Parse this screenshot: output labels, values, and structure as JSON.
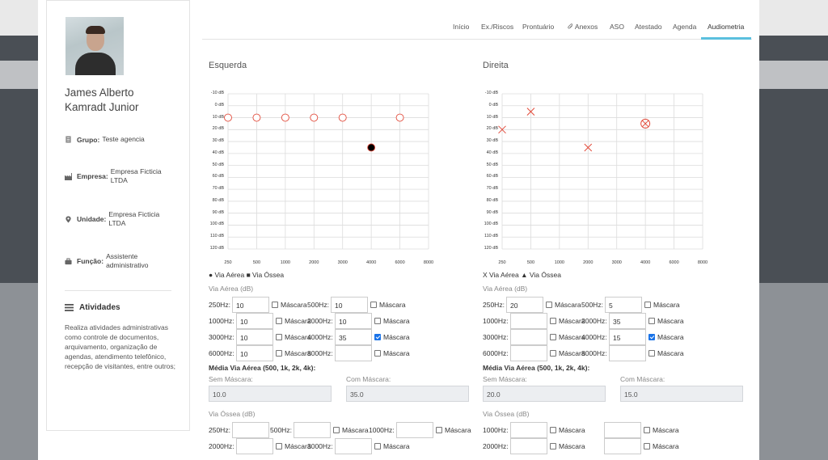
{
  "patient": {
    "name": "James Alberto Kamradt Junior",
    "grupo_label": "Grupo:",
    "grupo": "Teste agencia",
    "empresa_label": "Empresa:",
    "empresa": "Empresa Ficticia LTDA",
    "unidade_label": "Unidade:",
    "unidade": "Empresa Ficticia LTDA",
    "funcao_label": "Função:",
    "funcao": "Assistente administrativo"
  },
  "atividades": {
    "title": "Atividades",
    "description": "Realiza atividades administrativas como controle de documentos, arquivamento, organização de agendas, atendimento telefônico, recepção de visitantes, entre outros;"
  },
  "tabs": [
    {
      "label": "Início"
    },
    {
      "label": "Ex./Riscos"
    },
    {
      "label": "Prontuário"
    },
    {
      "label": "Anexos",
      "icon": "paperclip-icon"
    },
    {
      "label": "ASO"
    },
    {
      "label": "Atestado"
    },
    {
      "label": "Agenda"
    },
    {
      "label": "Audiometria",
      "active": true
    }
  ],
  "audiogram": {
    "y_ticks": [
      "-10 dB",
      "0 dB",
      "10 dB",
      "20 dB",
      "30 dB",
      "40 dB",
      "50 dB",
      "60 dB",
      "70 dB",
      "80 dB",
      "90 dB",
      "100 dB",
      "110 dB",
      "120 dB"
    ],
    "x_ticks": [
      "250",
      "500",
      "1000",
      "2000",
      "3000",
      "4000",
      "6000",
      "8000"
    ],
    "left": {
      "title": "Esquerda",
      "legend": "● Via Aérea ■ Via Óssea",
      "points": [
        {
          "freq": "250",
          "db": 10,
          "marker": "open-circle"
        },
        {
          "freq": "500",
          "db": 10,
          "marker": "open-circle"
        },
        {
          "freq": "1000",
          "db": 10,
          "marker": "open-circle"
        },
        {
          "freq": "2000",
          "db": 10,
          "marker": "open-circle"
        },
        {
          "freq": "3000",
          "db": 10,
          "marker": "open-circle"
        },
        {
          "freq": "4000",
          "db": 35,
          "marker": "filled-circle"
        },
        {
          "freq": "6000",
          "db": 10,
          "marker": "open-circle"
        }
      ],
      "marker_color": "#e24c3c"
    },
    "right": {
      "title": "Direita",
      "legend": "X Via Aérea ▲ Via Óssea",
      "points": [
        {
          "freq": "250",
          "db": 20,
          "marker": "x"
        },
        {
          "freq": "500",
          "db": 5,
          "marker": "x"
        },
        {
          "freq": "2000",
          "db": 35,
          "marker": "x"
        },
        {
          "freq": "4000",
          "db": 15,
          "marker": "circled-x"
        }
      ],
      "marker_color": "#e24c3c"
    }
  },
  "form": {
    "via_aerea_label": "Via Aérea (dB)",
    "via_ossea_label": "Via Óssea (dB)",
    "mascara_label": "Máscara",
    "media_title": "Média Via Aérea (500, 1k, 2k, 4k):",
    "sem_mascara_label": "Sem Máscara:",
    "com_mascara_label": "Com Máscara:",
    "left": {
      "aerea": {
        "250Hz": {
          "label": "250Hz:",
          "value": "10",
          "mask": false
        },
        "500Hz": {
          "label": "500Hz:",
          "value": "10",
          "mask": false
        },
        "1000Hz": {
          "label": "1000Hz:",
          "value": "10",
          "mask": false
        },
        "2000Hz": {
          "label": "2000Hz:",
          "value": "10",
          "mask": false
        },
        "3000Hz": {
          "label": "3000Hz:",
          "value": "10",
          "mask": false
        },
        "4000Hz": {
          "label": "4000Hz:",
          "value": "35",
          "mask": true
        },
        "6000Hz": {
          "label": "6000Hz:",
          "value": "10",
          "mask": false
        },
        "8000Hz": {
          "label": "8000Hz:",
          "value": "",
          "mask": false
        }
      },
      "media_sem": "10.0",
      "media_com": "35.0",
      "ossea": {
        "250Hz": {
          "label": "250Hz:"
        },
        "500Hz": {
          "label": "500Hz:"
        },
        "1000Hz": {
          "label": "1000Hz:"
        },
        "2000Hz": {
          "label": "2000Hz:"
        },
        "3000Hz": {
          "label": "3000Hz:"
        }
      }
    },
    "right": {
      "aerea": {
        "250Hz": {
          "label": "250Hz:",
          "value": "20",
          "mask": false
        },
        "500Hz": {
          "label": "500Hz:",
          "value": "5",
          "mask": false
        },
        "1000Hz": {
          "label": "1000Hz:",
          "value": "",
          "mask": false
        },
        "2000Hz": {
          "label": "2000Hz:",
          "value": "35",
          "mask": false
        },
        "3000Hz": {
          "label": "3000Hz:",
          "value": "",
          "mask": false
        },
        "4000Hz": {
          "label": "4000Hz:",
          "value": "15",
          "mask": true
        },
        "6000Hz": {
          "label": "6000Hz:",
          "value": "",
          "mask": false
        },
        "8000Hz": {
          "label": "8000Hz:",
          "value": "",
          "mask": false
        }
      },
      "media_sem": "20.0",
      "media_com": "15.0",
      "ossea": {
        "1000Hz": {
          "label": "1000Hz:"
        },
        "2000Hz": {
          "label": "2000Hz:"
        }
      }
    }
  }
}
